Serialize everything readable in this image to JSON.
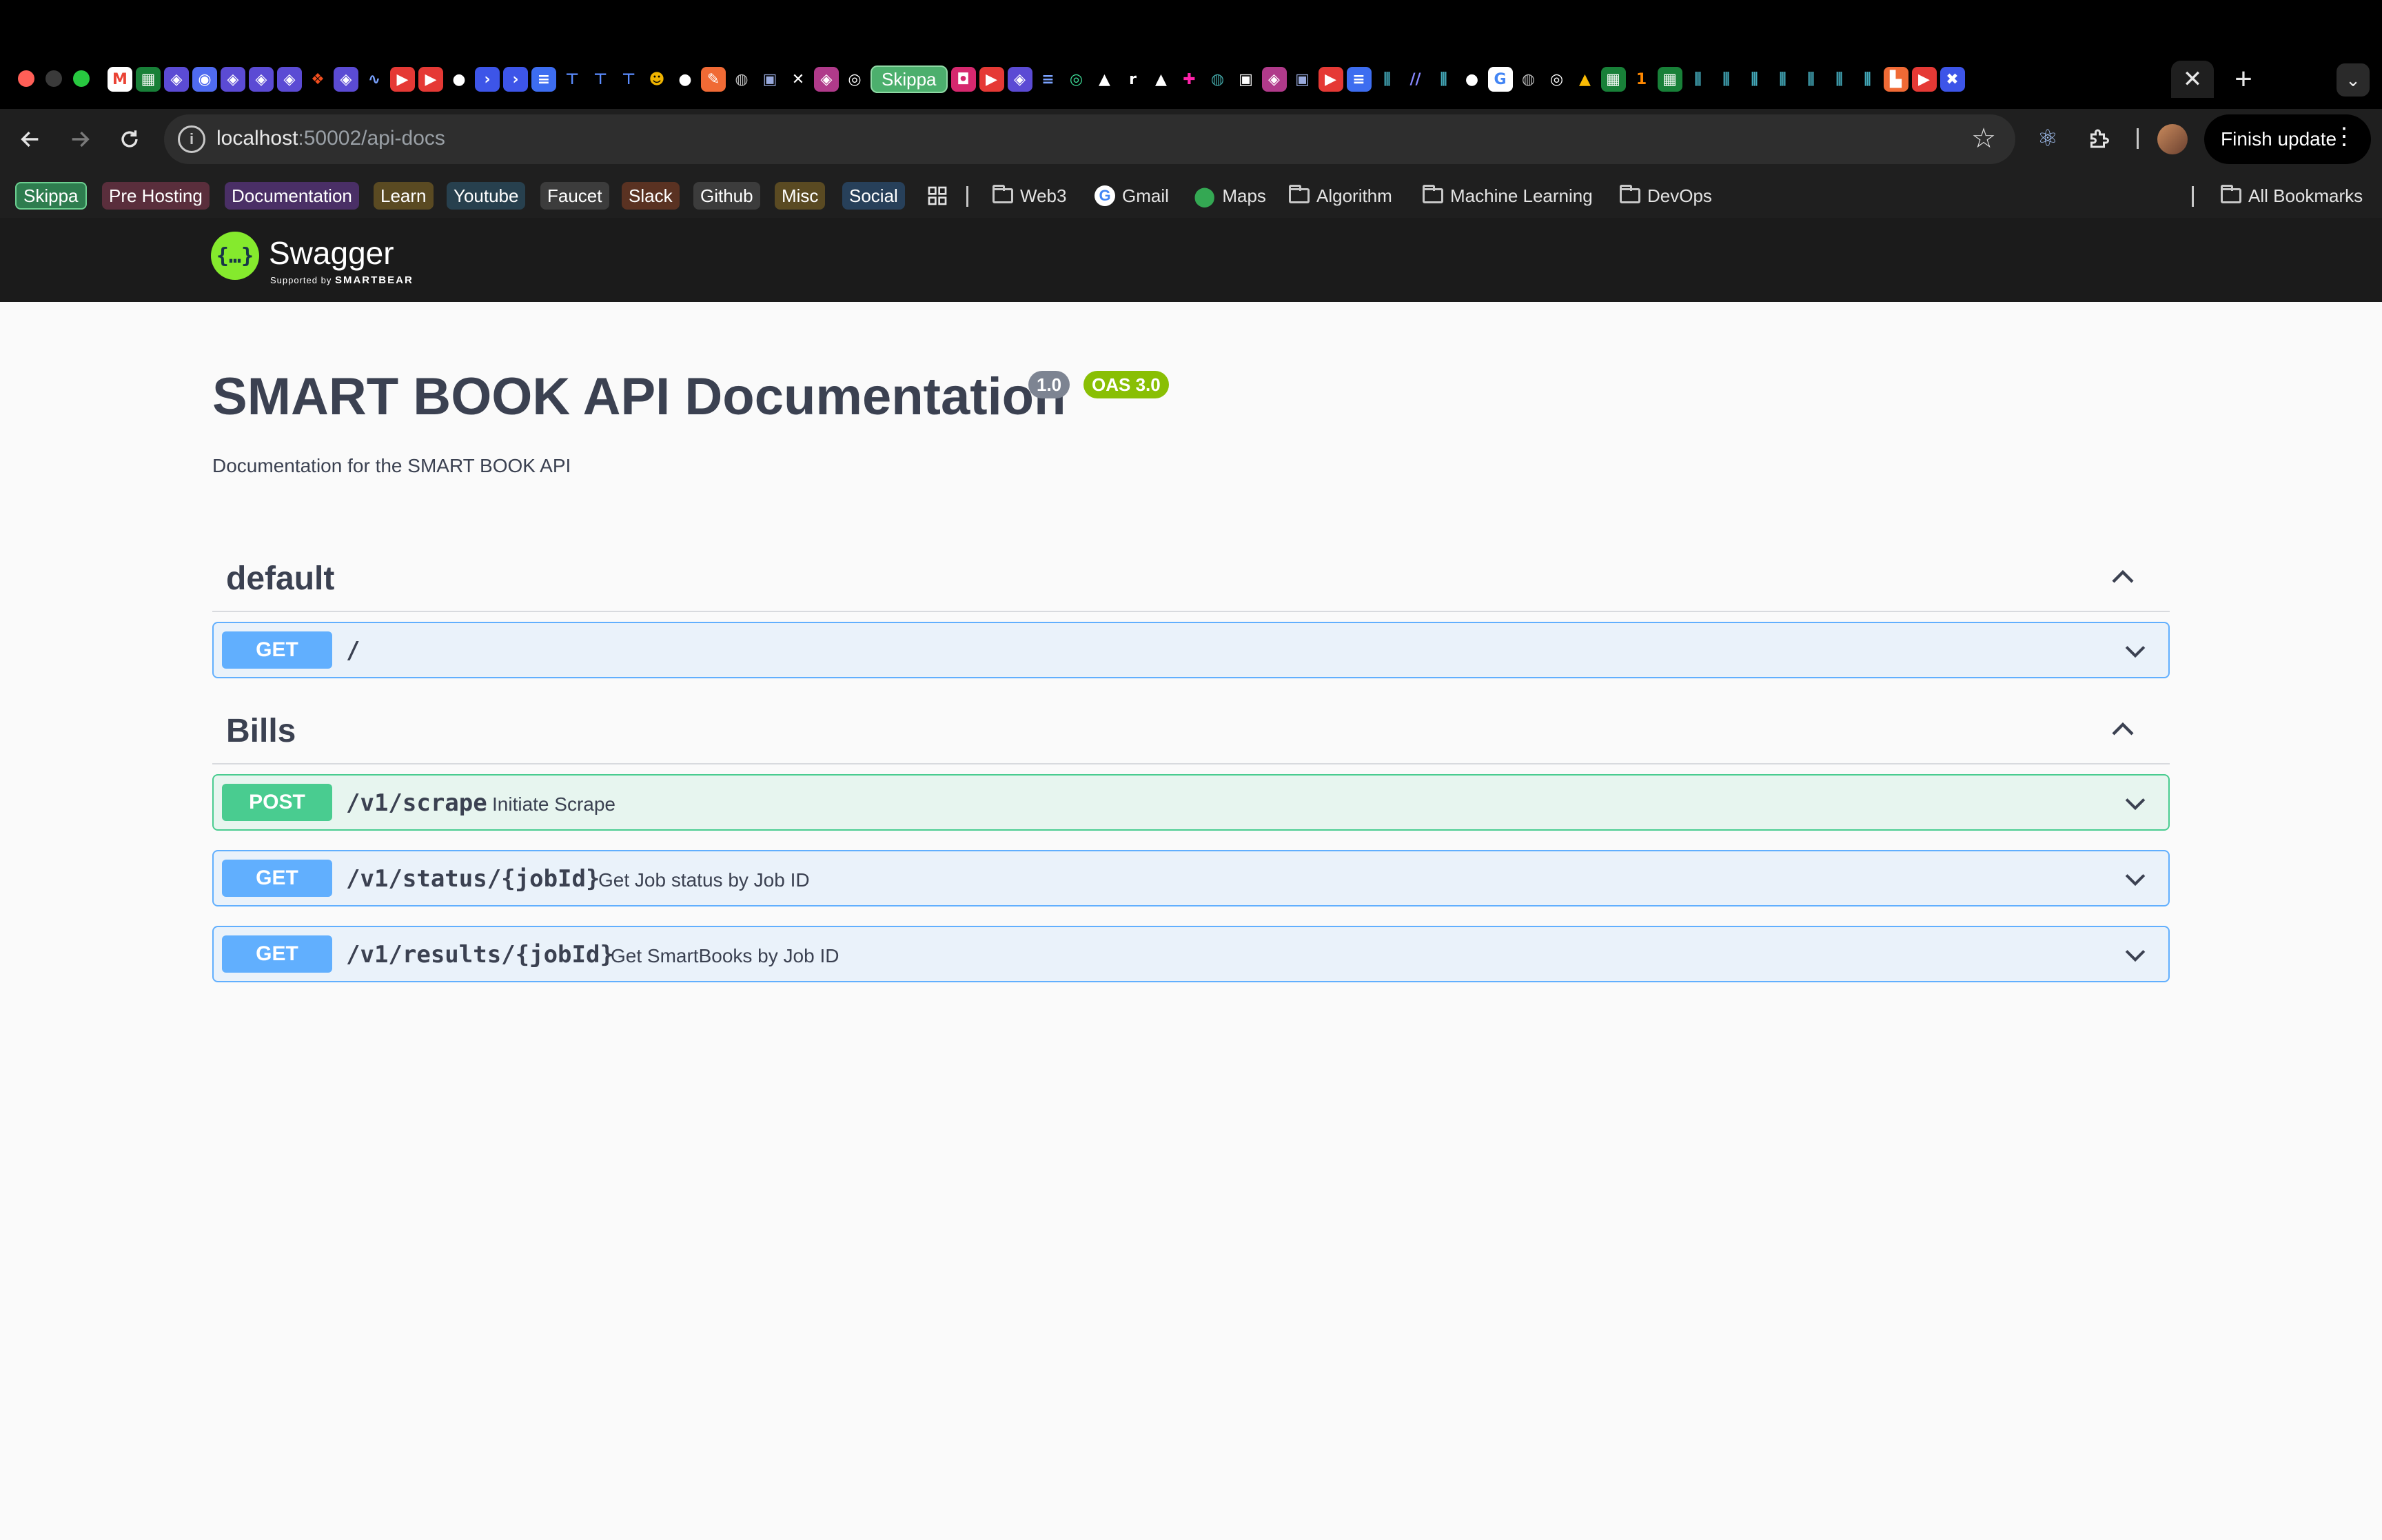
{
  "browser": {
    "tab_strip": {
      "pinned_tab_label": "Skippa",
      "close_glyph": "✕",
      "new_tab_glyph": "+",
      "tab_search_glyph": "⌄"
    },
    "address_bar": {
      "host": "localhost",
      "path": ":50002/api-docs"
    },
    "finish_update_label": "Finish update",
    "bookmarks": {
      "chips": [
        {
          "label": "Skippa",
          "color": "#2e7d4f"
        },
        {
          "label": "Pre Hosting",
          "color": "#7a3b4f"
        },
        {
          "label": "Documentation",
          "color": "#5b3a7a"
        },
        {
          "label": "Learn",
          "color": "#6b5a2a"
        },
        {
          "label": "Youtube",
          "color": "#2f4a5a"
        },
        {
          "label": "Faucet",
          "color": "#4a4a4a"
        },
        {
          "label": "Slack",
          "color": "#6a3b2a"
        },
        {
          "label": "Github",
          "color": "#4a4a4a"
        },
        {
          "label": "Misc",
          "color": "#6b5a2a"
        },
        {
          "label": "Social",
          "color": "#2f4a6a"
        }
      ],
      "folders": [
        {
          "label": "Web3",
          "icon": "folder-icon"
        },
        {
          "label": "Gmail",
          "icon": "google-icon"
        },
        {
          "label": "Maps",
          "icon": "maps-pin-icon"
        },
        {
          "label": "Algorithm",
          "icon": "folder-icon"
        },
        {
          "label": "Machine Learning",
          "icon": "folder-icon"
        },
        {
          "label": "DevOps",
          "icon": "folder-icon"
        }
      ],
      "all_bookmarks_label": "All Bookmarks"
    }
  },
  "swagger": {
    "brand": "Swagger",
    "brand_sub_prefix": "Supported by",
    "brand_sub_name": "SMARTBEAR",
    "info": {
      "title": "SMART BOOK API Documentation",
      "version": "1.0",
      "oas": "OAS 3.0",
      "description": "Documentation for the SMART BOOK API"
    },
    "tags": [
      {
        "name": "default",
        "operations": [
          {
            "method": "GET",
            "path": "/",
            "summary": ""
          }
        ]
      },
      {
        "name": "Bills",
        "operations": [
          {
            "method": "POST",
            "path": "/v1/scrape",
            "summary": "Initiate Scrape"
          },
          {
            "method": "GET",
            "path": "/v1/status/{jobId}",
            "summary": "Get Job status by Job ID"
          },
          {
            "method": "GET",
            "path": "/v1/results/{jobId}",
            "summary": "Get SmartBooks by Job ID"
          }
        ]
      }
    ],
    "colors": {
      "get": "#61affe",
      "post": "#49cc90",
      "version_badge": "#89939d",
      "oas_badge": "#89bf04",
      "text": "#3b4151"
    }
  }
}
